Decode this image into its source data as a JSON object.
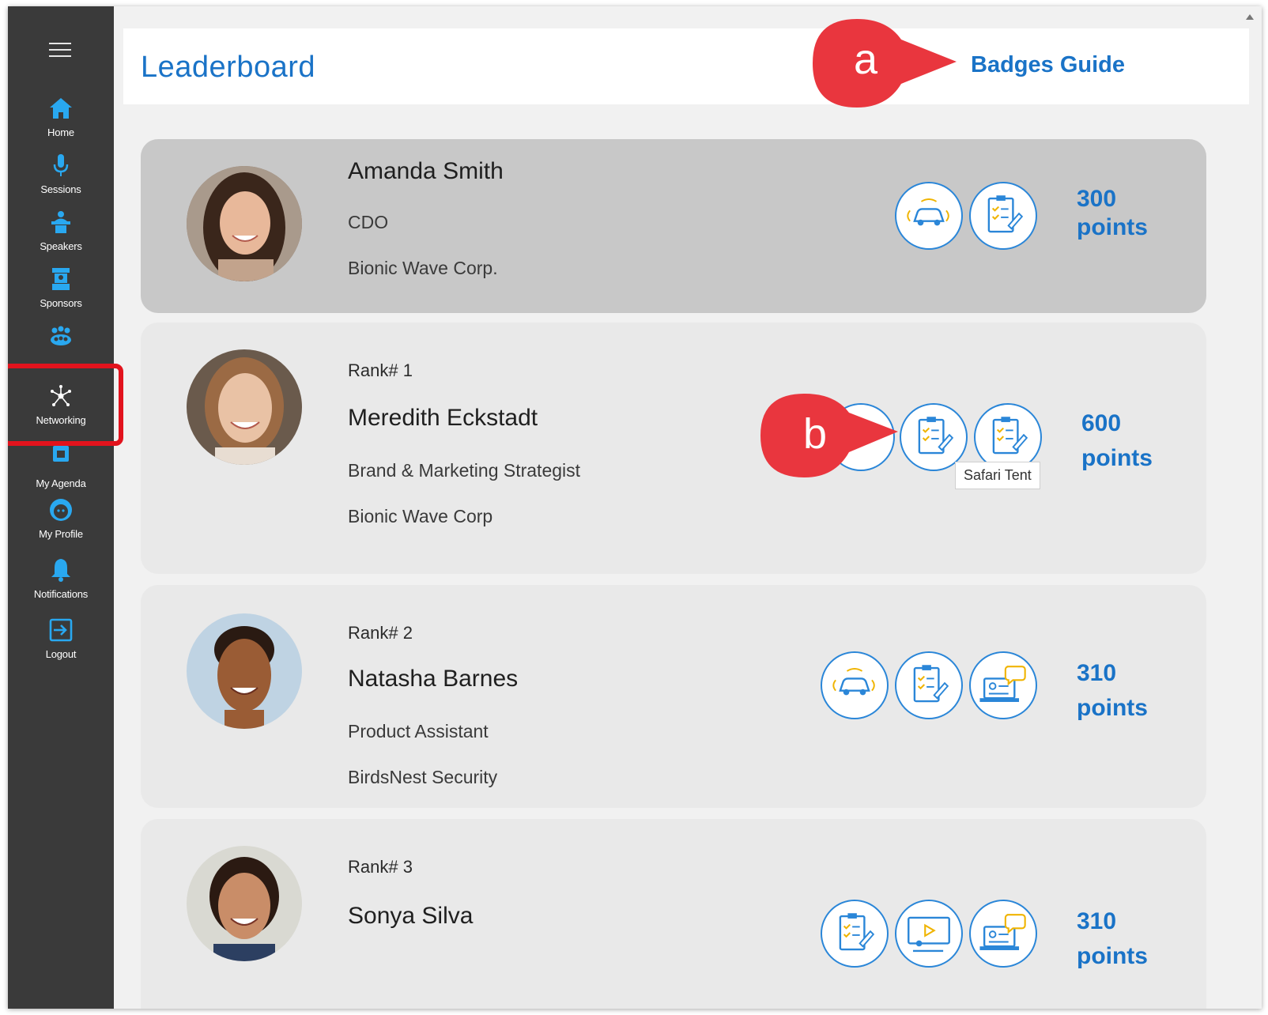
{
  "sidebar": {
    "items": [
      {
        "label": "Home",
        "icon": "home-icon"
      },
      {
        "label": "Sessions",
        "icon": "microphone-icon"
      },
      {
        "label": "Speakers",
        "icon": "speaker-podium-icon"
      },
      {
        "label": "Sponsors",
        "icon": "booth-icon"
      },
      {
        "label": "",
        "icon": "group-icon"
      },
      {
        "label": "Networking",
        "icon": "network-icon"
      },
      {
        "label": "My Agenda",
        "icon": "calendar-icon"
      },
      {
        "label": "My Profile",
        "icon": "profile-face-icon"
      },
      {
        "label": "Notifications",
        "icon": "bell-icon"
      },
      {
        "label": "Logout",
        "icon": "logout-icon"
      }
    ]
  },
  "header": {
    "title": "Leaderboard",
    "badges_guide": "Badges Guide"
  },
  "callouts": {
    "a": "a",
    "b": "b"
  },
  "current_user": {
    "name": "Amanda Smith",
    "title": "CDO",
    "company": "Bionic Wave Corp.",
    "points_value": "300",
    "points_unit": "points",
    "badges": [
      "car-badge-icon",
      "survey-badge-icon"
    ]
  },
  "leaders": [
    {
      "rank": "Rank# 1",
      "name": "Meredith Eckstadt",
      "title": "Brand & Marketing Strategist",
      "company": "Bionic Wave Corp",
      "points_value": "600",
      "points_unit": "points",
      "badges": [
        "survey-badge-icon",
        "survey-badge-icon",
        "survey-badge-icon"
      ],
      "tooltip": "Safari Tent"
    },
    {
      "rank": "Rank# 2",
      "name": "Natasha Barnes",
      "title": "Product Assistant",
      "company": "BirdsNest Security",
      "points_value": "310",
      "points_unit": "points",
      "badges": [
        "car-badge-icon",
        "survey-badge-icon",
        "chat-laptop-badge-icon"
      ]
    },
    {
      "rank": "Rank# 3",
      "name": "Sonya Silva",
      "title": "",
      "company": "",
      "points_value": "310",
      "points_unit": "points",
      "badges": [
        "survey-badge-icon",
        "presentation-badge-icon",
        "chat-laptop-badge-icon"
      ]
    }
  ],
  "colors": {
    "accent": "#1a73c7",
    "sidebar": "#3a3a3a",
    "icon": "#29a8f0",
    "callout": "#e9363e",
    "highlight": "#e2131d"
  }
}
